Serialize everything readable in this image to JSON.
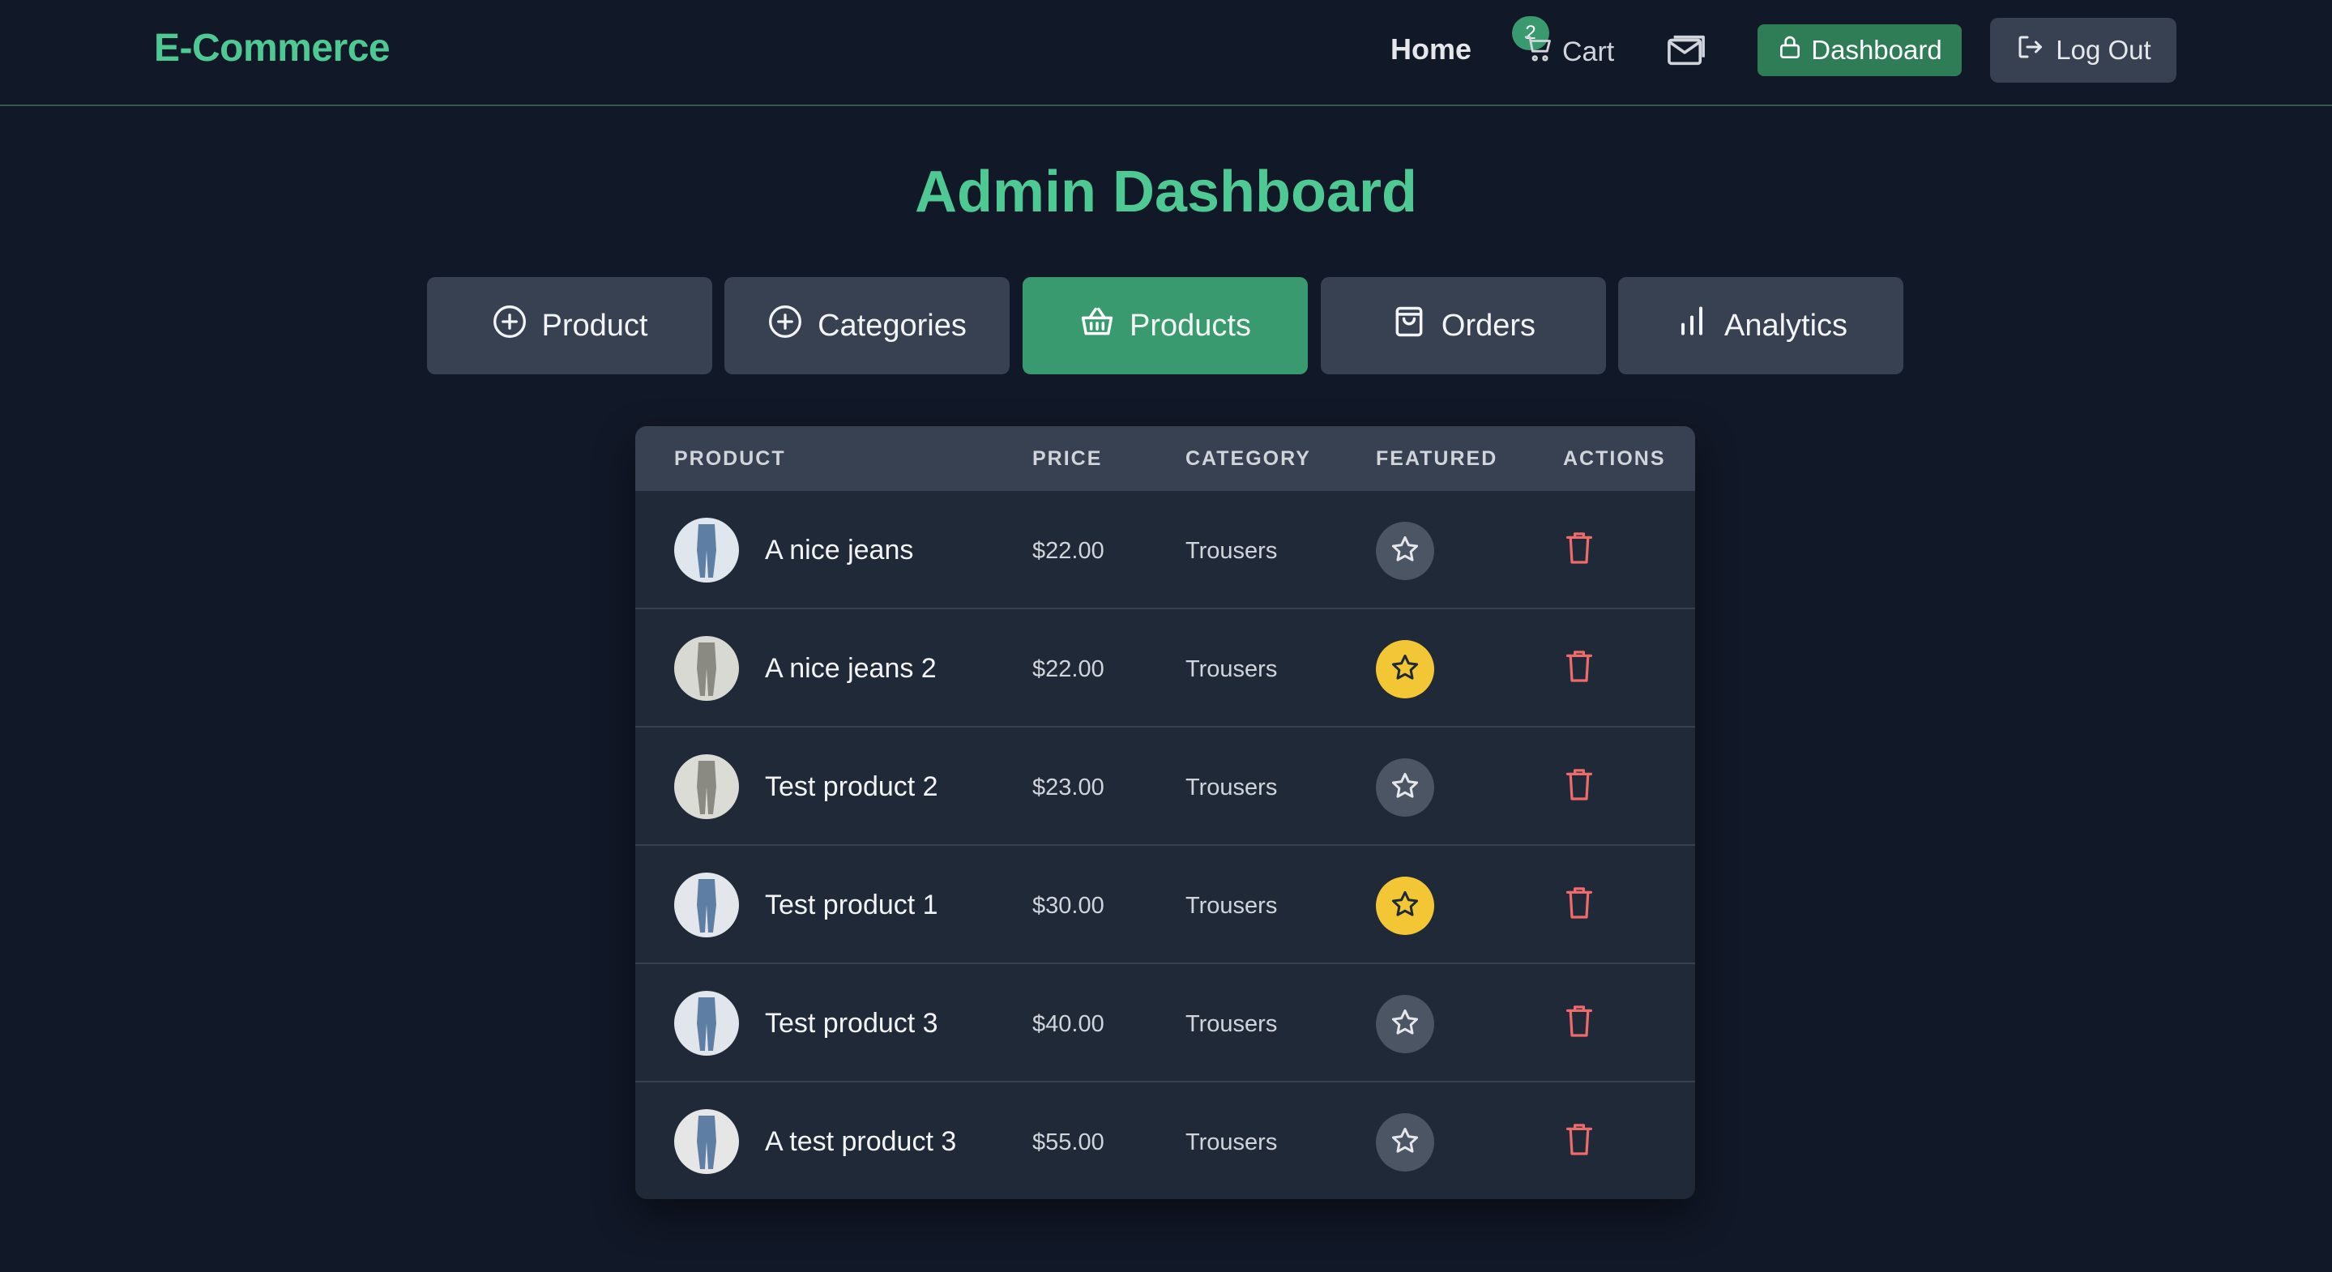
{
  "navbar": {
    "brand": "E-Commerce",
    "home_label": "Home",
    "cart_label": "Cart",
    "cart_count": "2",
    "dashboard_label": "Dashboard",
    "logout_label": "Log Out"
  },
  "page": {
    "title": "Admin Dashboard"
  },
  "tabs": [
    {
      "label": "Product",
      "icon": "plus-circle-icon",
      "active": false
    },
    {
      "label": "Categories",
      "icon": "plus-circle-icon",
      "active": false
    },
    {
      "label": "Products",
      "icon": "basket-icon",
      "active": true
    },
    {
      "label": "Orders",
      "icon": "shopping-bag-icon",
      "active": false
    },
    {
      "label": "Analytics",
      "icon": "bar-chart-icon",
      "active": false
    }
  ],
  "table": {
    "headers": [
      "PRODUCT",
      "PRICE",
      "CATEGORY",
      "FEATURED",
      "ACTIONS"
    ],
    "rows": [
      {
        "name": "A nice jeans",
        "price": "$22.00",
        "category": "Trousers",
        "featured": false
      },
      {
        "name": "A nice jeans 2",
        "price": "$22.00",
        "category": "Trousers",
        "featured": true
      },
      {
        "name": "Test product 2",
        "price": "$23.00",
        "category": "Trousers",
        "featured": false
      },
      {
        "name": "Test product 1",
        "price": "$30.00",
        "category": "Trousers",
        "featured": true
      },
      {
        "name": "Test product 3",
        "price": "$40.00",
        "category": "Trousers",
        "featured": false
      },
      {
        "name": "A test product 3",
        "price": "$55.00",
        "category": "Trousers",
        "featured": false
      }
    ]
  },
  "colors": {
    "accent": "#4fc994",
    "active_tab": "#3a9a6f",
    "featured_star": "#f2c634",
    "delete_icon": "#ef6b6b"
  }
}
